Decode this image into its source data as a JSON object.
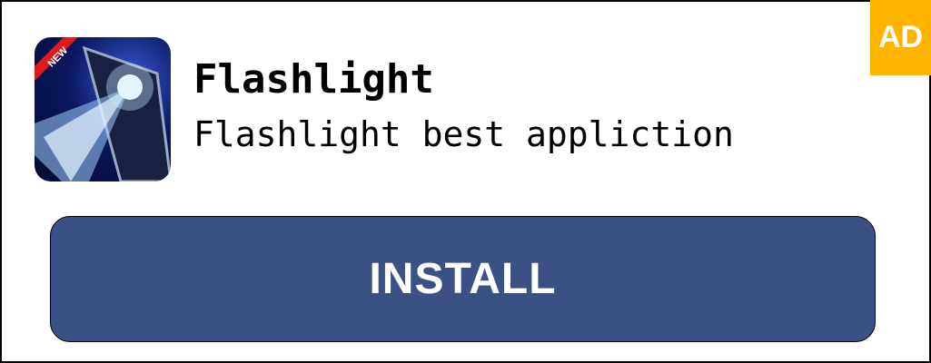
{
  "ad_badge": "AD",
  "app": {
    "icon_badge": "NEW",
    "title": "Flashlight",
    "subtitle": "Flashlight best appliction"
  },
  "install_label": "INSTALL"
}
